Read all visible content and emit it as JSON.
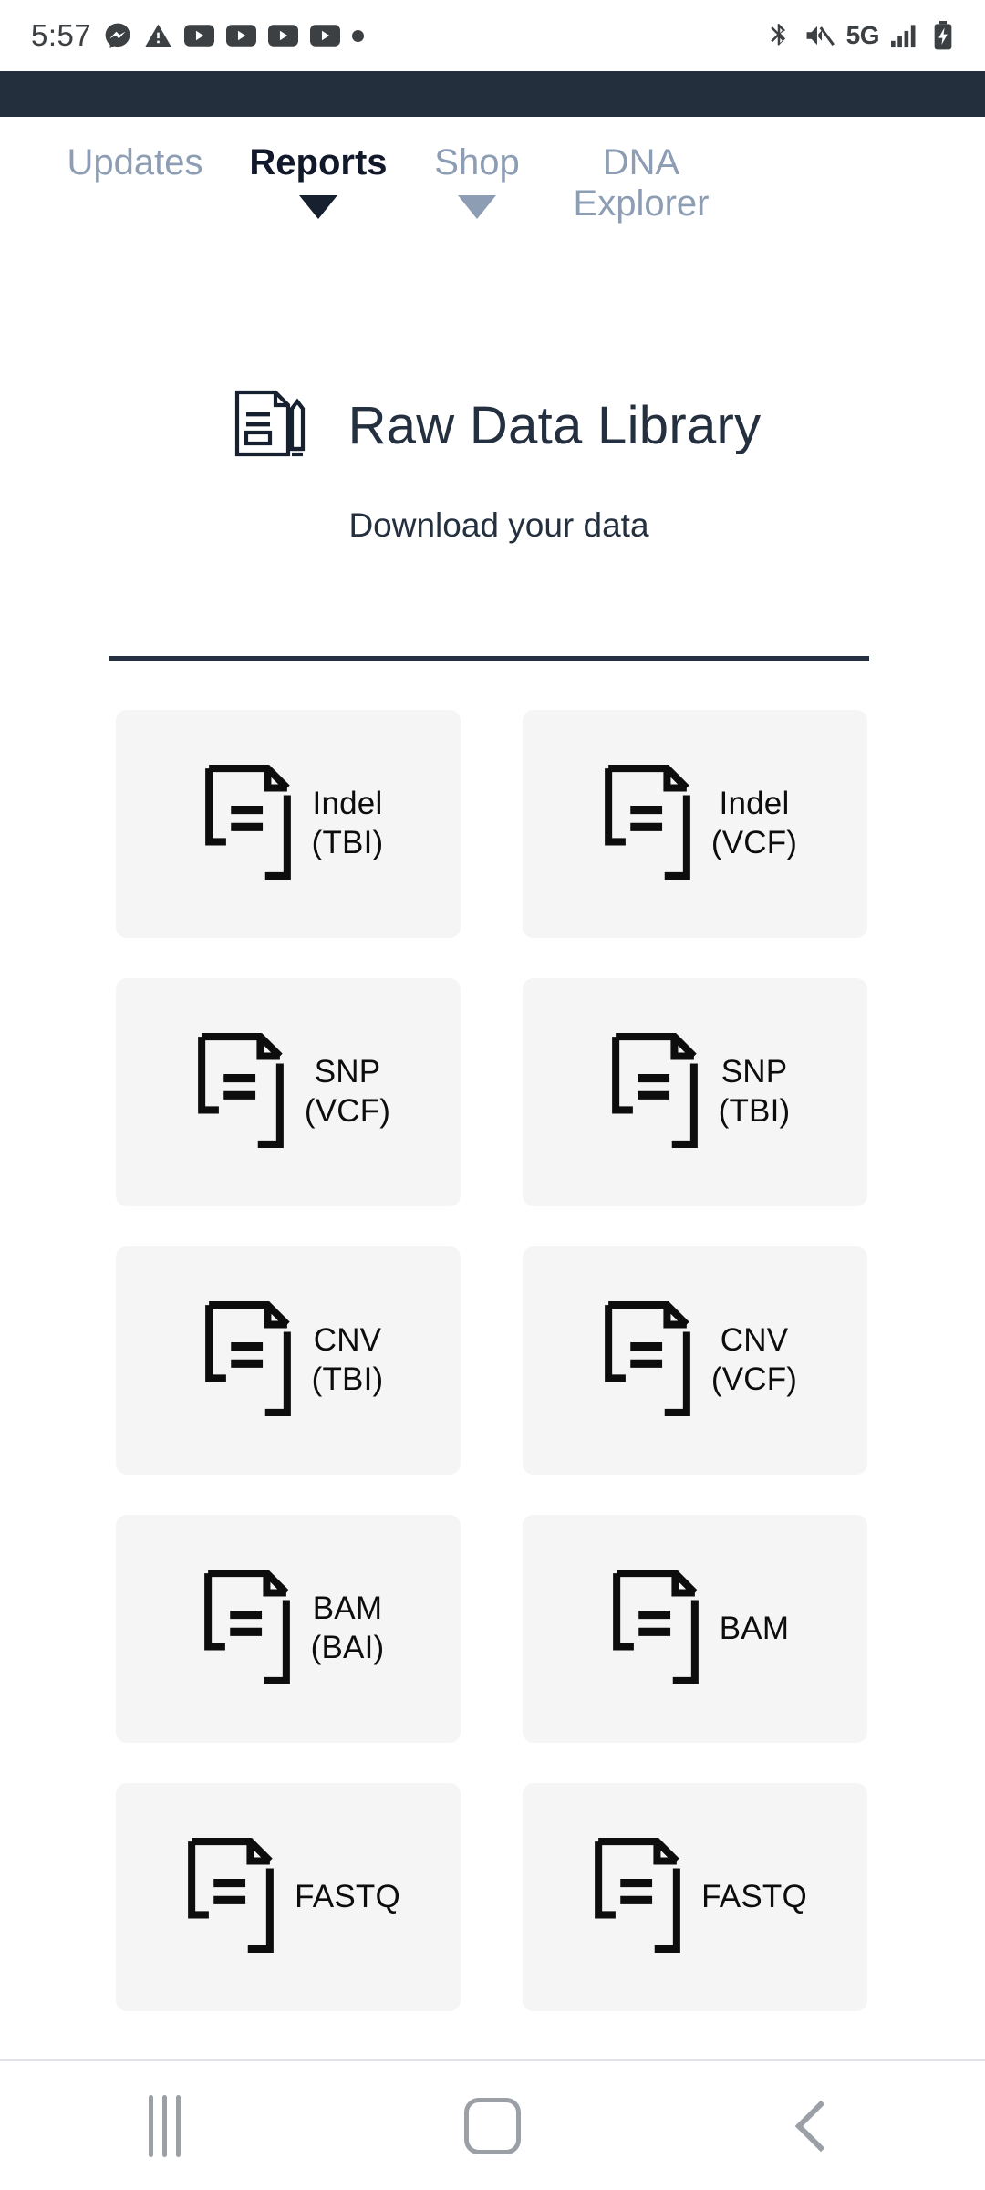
{
  "statusbar": {
    "time": "5:57",
    "left_icons": [
      "messenger-icon",
      "warning-icon",
      "youtube-icon",
      "youtube-icon",
      "youtube-icon",
      "youtube-icon",
      "dot-icon"
    ],
    "network_label": "5G",
    "right_icons": [
      "bluetooth-icon",
      "volume-mute-icon",
      "signal-bars-icon",
      "battery-charging-icon"
    ]
  },
  "nav": {
    "items": [
      {
        "label": "Updates",
        "active": false,
        "caret": false
      },
      {
        "label": "Reports",
        "active": true,
        "caret": true
      },
      {
        "label": "Shop",
        "active": false,
        "caret": true
      },
      {
        "label": "DNA Explorer",
        "active": false,
        "caret": false
      }
    ]
  },
  "header": {
    "icon": "document-pencil-icon",
    "title": "Raw Data Library",
    "subtitle": "Download your data"
  },
  "grid": {
    "cards": [
      {
        "label": "Indel\n(TBI)",
        "icon": "file-document-icon"
      },
      {
        "label": "Indel\n(VCF)",
        "icon": "file-document-icon"
      },
      {
        "label": "SNP\n(VCF)",
        "icon": "file-document-icon"
      },
      {
        "label": "SNP\n(TBI)",
        "icon": "file-document-icon"
      },
      {
        "label": "CNV\n(TBI)",
        "icon": "file-document-icon"
      },
      {
        "label": "CNV\n(VCF)",
        "icon": "file-document-icon"
      },
      {
        "label": "BAM\n(BAI)",
        "icon": "file-document-icon"
      },
      {
        "label": "BAM",
        "icon": "file-document-icon"
      },
      {
        "label": "FASTQ",
        "icon": "file-document-icon"
      },
      {
        "label": "FASTQ",
        "icon": "file-document-icon"
      }
    ]
  },
  "navbar": {
    "buttons": [
      "recents-button",
      "home-button",
      "back-button"
    ]
  },
  "colors": {
    "dark_navy": "#242f3e",
    "nav_inactive": "#8d9db4",
    "card_bg": "#f5f5f5",
    "text_dark": "#24303f"
  }
}
